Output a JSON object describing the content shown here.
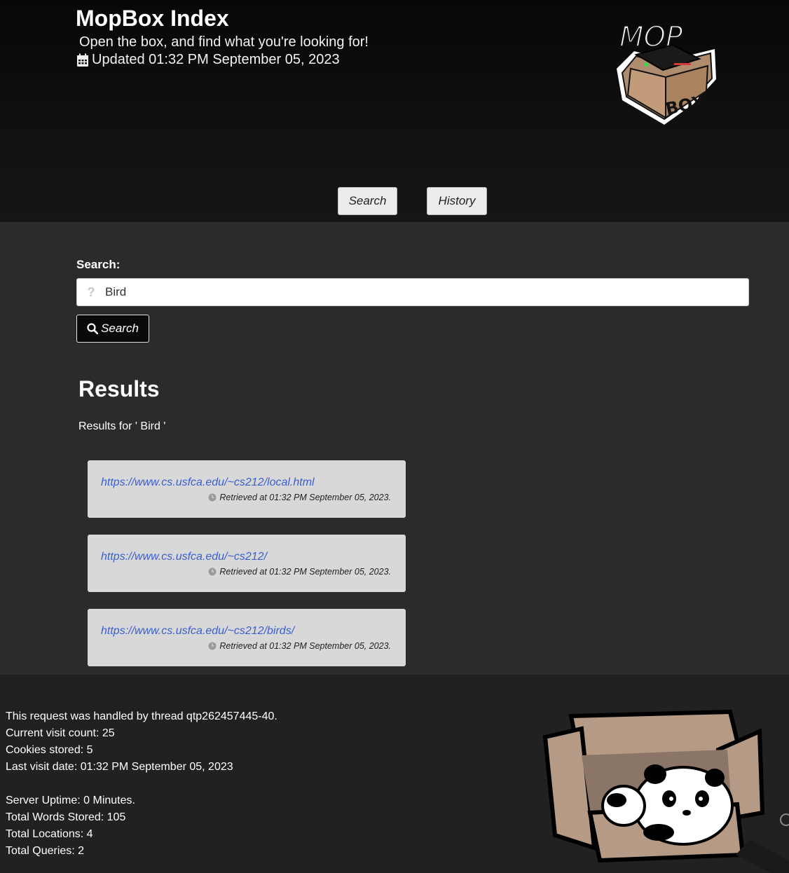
{
  "header": {
    "title": "MopBox Index",
    "subtitle": "Open the box, and find what you're looking for!",
    "updated": "Updated 01:32 PM September 05, 2023",
    "logo_text_top": "MOP",
    "logo_text_bottom": "BOX"
  },
  "nav": {
    "search_label": "Search",
    "history_label": "History"
  },
  "search": {
    "label": "Search:",
    "value": "Bird",
    "icon": "question-icon",
    "button_label": "Search"
  },
  "results": {
    "title": "Results",
    "summary": "Results for ' Bird '",
    "items": [
      {
        "url": "https://www.cs.usfca.edu/~cs212/local.html",
        "retrieved": "Retrieved at 01:32 PM September 05, 2023."
      },
      {
        "url": "https://www.cs.usfca.edu/~cs212/",
        "retrieved": "Retrieved at 01:32 PM September 05, 2023."
      },
      {
        "url": "https://www.cs.usfca.edu/~cs212/birds/",
        "retrieved": "Retrieved at 01:32 PM September 05, 2023."
      }
    ]
  },
  "footer": {
    "thread": "This request was handled by thread qtp262457445-40.",
    "visit_count": "Current visit count: 25",
    "cookies": "Cookies stored: 5",
    "last_visit": "Last visit date: 01:32 PM September 05, 2023",
    "uptime": "Server Uptime: 0 Minutes.",
    "words": "Total Words Stored: 105",
    "locations": "Total Locations: 4",
    "queries": "Total Queries: 2"
  },
  "colors": {
    "hero_bg": "#0b0b0b",
    "page_bg": "#2b2b2b",
    "footer_bg": "#212121",
    "card_bg": "#d8d8d8",
    "link": "#3a5fcd"
  }
}
